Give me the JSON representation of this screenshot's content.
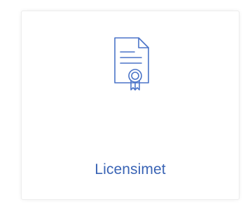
{
  "tile": {
    "label": "Licensimet",
    "icon": "certificate-icon",
    "accent_color": "#3a64b5"
  }
}
